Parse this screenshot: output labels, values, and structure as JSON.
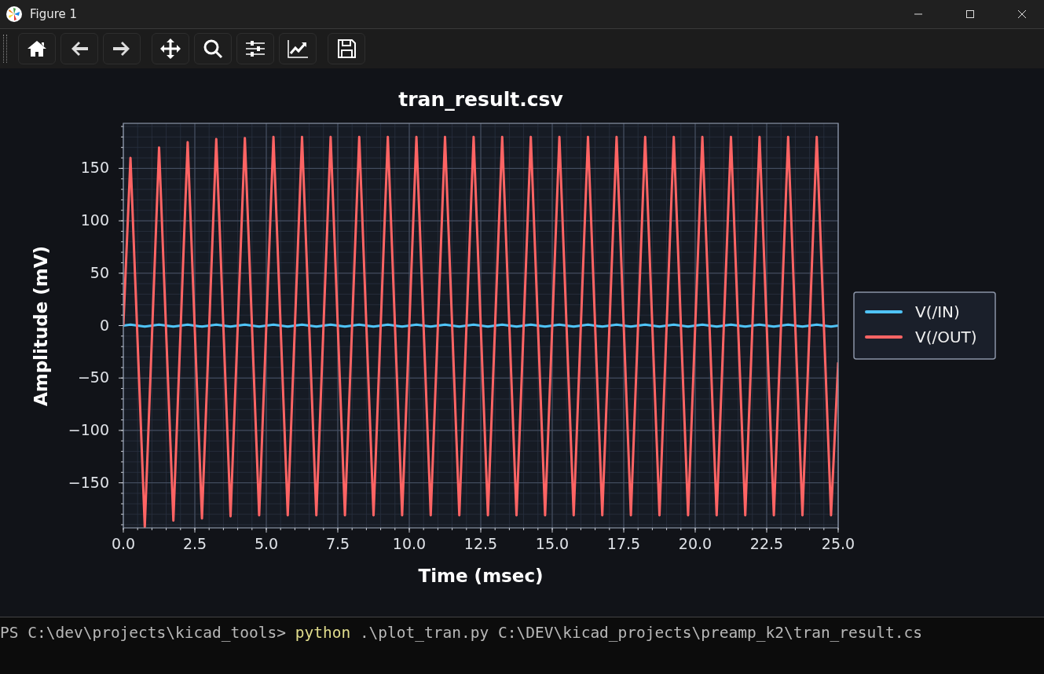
{
  "window": {
    "title": "Figure 1"
  },
  "toolbar": [
    [
      {
        "kind": "home"
      },
      {
        "kind": "back"
      },
      {
        "kind": "forward"
      }
    ],
    [
      {
        "kind": "pan"
      },
      {
        "kind": "zoom"
      },
      {
        "kind": "subplots"
      },
      {
        "kind": "axes"
      }
    ],
    [
      {
        "kind": "save"
      }
    ]
  ],
  "figure": {
    "chart_data": {
      "type": "line",
      "title": "tran_result.csv",
      "xlabel": "Time (msec)",
      "ylabel": "Amplitude (mV)",
      "x": [
        0,
        0.25,
        0.75,
        1.25,
        1.75,
        2.25,
        2.75,
        3.25,
        3.75,
        4.25,
        4.75,
        5.25,
        5.75,
        6.25,
        6.75,
        7.25,
        7.75,
        8.25,
        8.75,
        9.25,
        9.75,
        10.25,
        10.75,
        11.25,
        11.75,
        12.25,
        12.75,
        13.25,
        13.75,
        14.25,
        14.75,
        15.25,
        15.75,
        16.25,
        16.75,
        17.25,
        17.75,
        18.25,
        18.75,
        19.25,
        19.75,
        20.25,
        20.75,
        21.25,
        21.75,
        22.25,
        22.75,
        23.25,
        23.75,
        24.25,
        24.75,
        25
      ],
      "series": [
        {
          "name": "V(/IN)",
          "color": "#4fc3f7",
          "values": [
            0,
            1,
            -1,
            1,
            -1,
            1,
            -1,
            1,
            -1,
            1,
            -1,
            1,
            -1,
            1,
            -1,
            1,
            -1,
            1,
            -1,
            1,
            -1,
            1,
            -1,
            1,
            -1,
            1,
            -1,
            1,
            -1,
            1,
            -1,
            1,
            -1,
            1,
            -1,
            1,
            -1,
            1,
            -1,
            1,
            -1,
            1,
            -1,
            1,
            -1,
            1,
            -1,
            1,
            -1,
            1,
            -1,
            0
          ]
        },
        {
          "name": "V(/OUT)",
          "color": "#ff6464",
          "values": [
            0,
            160,
            -192,
            170,
            -186,
            175,
            -184,
            178,
            -182,
            179,
            -181,
            180,
            -181,
            180,
            -181,
            180,
            -181,
            180,
            -181,
            180,
            -181,
            180,
            -181,
            180,
            -181,
            180,
            -181,
            180,
            -181,
            180,
            -181,
            180,
            -181,
            180,
            -181,
            180,
            -181,
            180,
            -181,
            180,
            -181,
            180,
            -181,
            180,
            -181,
            180,
            -181,
            180,
            -181,
            180,
            -181,
            -35
          ]
        }
      ],
      "grid": true,
      "legend": true,
      "xlim": [
        0,
        25
      ],
      "ylim": [
        -193,
        193
      ],
      "xticks": [
        {
          "value": 0,
          "label": "0.0"
        },
        {
          "value": 2.5,
          "label": "2.5"
        },
        {
          "value": 5,
          "label": "5.0"
        },
        {
          "value": 7.5,
          "label": "7.5"
        },
        {
          "value": 10,
          "label": "10.0"
        },
        {
          "value": 12.5,
          "label": "12.5"
        },
        {
          "value": 15,
          "label": "15.0"
        },
        {
          "value": 17.5,
          "label": "17.5"
        },
        {
          "value": 20,
          "label": "20.0"
        },
        {
          "value": 22.5,
          "label": "22.5"
        },
        {
          "value": 25,
          "label": "25.0"
        }
      ],
      "yticks": [
        {
          "value": -150,
          "label": "−150"
        },
        {
          "value": -100,
          "label": "−100"
        },
        {
          "value": -50,
          "label": "−50"
        },
        {
          "value": 0,
          "label": "0"
        },
        {
          "value": 50,
          "label": "50"
        },
        {
          "value": 100,
          "label": "100"
        },
        {
          "value": 150,
          "label": "150"
        }
      ]
    }
  },
  "terminal": {
    "prompt": "PS C:\\dev\\projects\\kicad_tools> ",
    "command": "python",
    "arguments": " .\\plot_tran.py C:\\DEV\\kicad_projects\\preamp_k2\\tran_result.cs"
  }
}
